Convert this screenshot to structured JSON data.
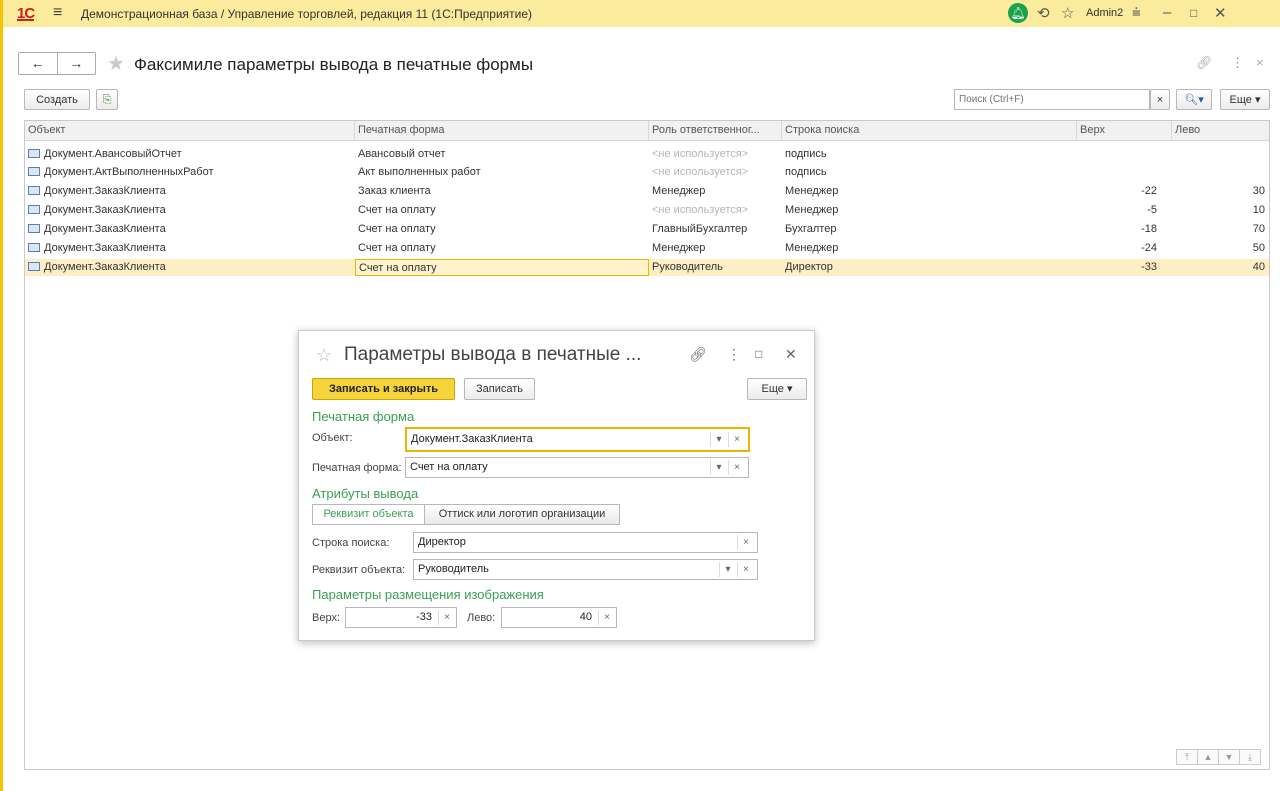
{
  "titlebar": {
    "logo": "1С",
    "title": "Демонстрационная база / Управление торговлей, редакция 11  (1С:Предприятие)",
    "user": "Admin2"
  },
  "header": {
    "title": "Факсимиле параметры вывода в печатные формы",
    "create_label": "Создать",
    "search_placeholder": "Поиск (Ctrl+F)",
    "more_label": "Еще"
  },
  "table": {
    "columns": [
      "Объект",
      "Печатная форма",
      "Роль ответственног...",
      "Строка поиска",
      "Верх",
      "Лево"
    ],
    "rows": [
      {
        "object": "Документ.АвансовыйОтчет",
        "form": "Авансовый отчет",
        "role": "<не используется>",
        "search": "подпись",
        "top": "",
        "left": ""
      },
      {
        "object": "Документ.АктВыполненныхРабот",
        "form": "Акт выполненных работ",
        "role": "<не используется>",
        "search": "подпись",
        "top": "",
        "left": ""
      },
      {
        "object": "Документ.ЗаказКлиента",
        "form": "Заказ клиента",
        "role": "Менеджер",
        "search": "Менеджер",
        "top": "-22",
        "left": "30"
      },
      {
        "object": "Документ.ЗаказКлиента",
        "form": "Счет на оплату",
        "role": "<не используется>",
        "search": "Менеджер",
        "top": "-5",
        "left": "10"
      },
      {
        "object": "Документ.ЗаказКлиента",
        "form": "Счет на оплату",
        "role": "ГлавныйБухгалтер",
        "search": "Бухгалтер",
        "top": "-18",
        "left": "70"
      },
      {
        "object": "Документ.ЗаказКлиента",
        "form": "Счет на оплату",
        "role": "Менеджер",
        "search": "Менеджер",
        "top": "-24",
        "left": "50"
      },
      {
        "object": "Документ.ЗаказКлиента",
        "form": "Счет на оплату",
        "role": "Руководитель",
        "search": "Директор",
        "top": "-33",
        "left": "40"
      }
    ]
  },
  "dialog": {
    "title": "Параметры вывода в печатные ...",
    "save_close_label": "Записать и закрыть",
    "save_label": "Записать",
    "more_label": "Еще",
    "group_print_form": "Печатная форма",
    "object_label": "Объект:",
    "object_value": "Документ.ЗаказКлиента",
    "print_form_label": "Печатная форма:",
    "print_form_value": "Счет на оплату",
    "group_output": "Атрибуты вывода",
    "tab_requisite": "Реквизит объекта",
    "tab_stamp": "Оттиск или логотип организации",
    "search_label": "Строка поиска:",
    "search_value": "Директор",
    "requisite_label": "Реквизит объекта:",
    "requisite_value": "Руководитель",
    "group_placement": "Параметры размещения изображения",
    "top_label": "Верх:",
    "top_value": "-33",
    "left_label": "Лево:",
    "left_value": "40"
  }
}
